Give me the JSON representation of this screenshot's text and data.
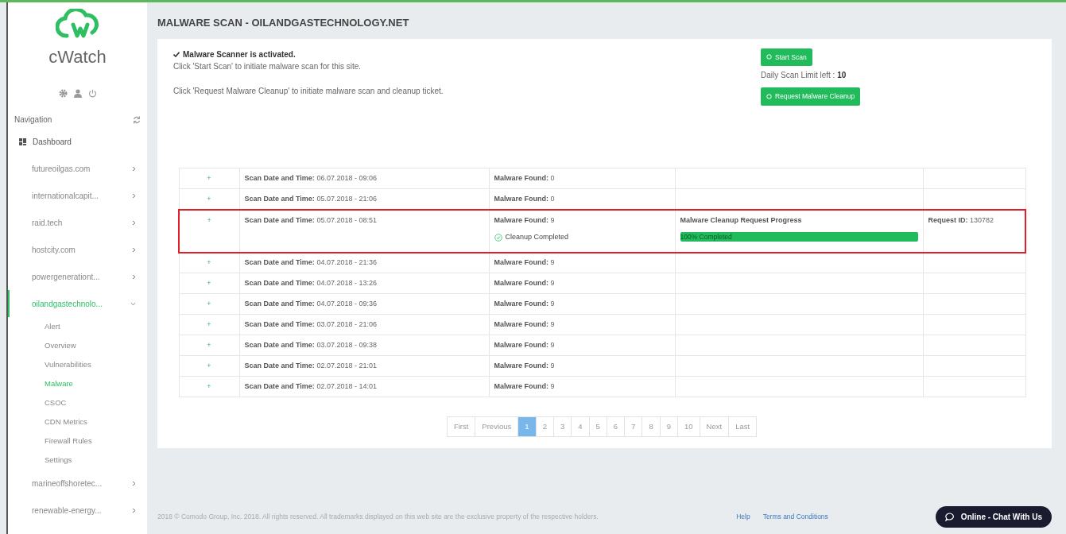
{
  "sidebar": {
    "brand": "cWatch",
    "nav_label": "Navigation",
    "dashboard": "Dashboard",
    "sites": [
      {
        "label": "futureoilgas.com",
        "expanded": false
      },
      {
        "label": "internationalcapit...",
        "expanded": false
      },
      {
        "label": "raid.tech",
        "expanded": false
      },
      {
        "label": "hostcity.com",
        "expanded": false
      },
      {
        "label": "powergenerationt...",
        "expanded": false
      },
      {
        "label": "oilandgastechnolo...",
        "expanded": true,
        "children": [
          {
            "label": "Alert",
            "selected": false
          },
          {
            "label": "Overview",
            "selected": false
          },
          {
            "label": "Vulnerabilities",
            "selected": false
          },
          {
            "label": "Malware",
            "selected": true
          },
          {
            "label": "CSOC",
            "selected": false
          },
          {
            "label": "CDN Metrics",
            "selected": false
          },
          {
            "label": "Firewall Rules",
            "selected": false
          },
          {
            "label": "Settings",
            "selected": false
          }
        ]
      },
      {
        "label": "marineoffshoretec...",
        "expanded": false
      },
      {
        "label": "renewable-energy...",
        "expanded": false
      }
    ]
  },
  "page_title": "MALWARE SCAN - OILANDGASTECHNOLOGY.NET",
  "info": {
    "status": "Malware Scanner is activated.",
    "line_1": "Click 'Start Scan' to initiate malware scan for this site.",
    "line_2": "Click 'Request Malware Cleanup' to initiate malware scan and cleanup ticket.",
    "start_button": "Start Scan",
    "limit_label": "Daily Scan Limit left : ",
    "limit_value": "10",
    "cleanup_button": "Request Malware Cleanup"
  },
  "scans": [
    {
      "kind": "plain",
      "expand": "+",
      "date_label": "Scan Date and Time:",
      "date": "06.07.2018 - 09:06",
      "found_label": "Malware Found:",
      "found": "0",
      "highlighted": false
    },
    {
      "kind": "plain",
      "expand": "+",
      "date_label": "Scan Date and Time:",
      "date": "05.07.2018 - 21:06",
      "found_label": "Malware Found:",
      "found": "0",
      "highlighted": false
    },
    {
      "kind": "cleanup",
      "expand": "+",
      "date_label": "Scan Date and Time:",
      "date": "05.07.2018 - 08:51",
      "found_label": "Malware Found:",
      "found": "9",
      "highlighted": true,
      "cleanup_status": "Cleanup Completed",
      "progress_title": "Malware Cleanup Request Progress",
      "progress_text": "100% Completed",
      "level": 1,
      "request_label": "Request ID:",
      "request_id": "130782"
    },
    {
      "kind": "plain",
      "expand": "+",
      "date_label": "Scan Date and Time:",
      "date": "04.07.2018 - 21:36",
      "found_label": "Malware Found:",
      "found": "9",
      "highlighted": false
    },
    {
      "kind": "plain",
      "expand": "+",
      "date_label": "Scan Date and Time:",
      "date": "04.07.2018 - 13:26",
      "found_label": "Malware Found:",
      "found": "9",
      "highlighted": false
    },
    {
      "kind": "plain",
      "expand": "+",
      "date_label": "Scan Date and Time:",
      "date": "04.07.2018 - 09:36",
      "found_label": "Malware Found:",
      "found": "9",
      "highlighted": false
    },
    {
      "kind": "plain",
      "expand": "+",
      "date_label": "Scan Date and Time:",
      "date": "03.07.2018 - 21:06",
      "found_label": "Malware Found:",
      "found": "9",
      "highlighted": false
    },
    {
      "kind": "plain",
      "expand": "+",
      "date_label": "Scan Date and Time:",
      "date": "03.07.2018 - 09:38",
      "found_label": "Malware Found:",
      "found": "9",
      "highlighted": false
    },
    {
      "kind": "plain",
      "expand": "+",
      "date_label": "Scan Date and Time:",
      "date": "02.07.2018 - 21:01",
      "found_label": "Malware Found:",
      "found": "9",
      "highlighted": false
    },
    {
      "kind": "plain",
      "expand": "+",
      "date_label": "Scan Date and Time:",
      "date": "02.07.2018 - 14:01",
      "found_label": "Malware Found:",
      "found": "9",
      "highlighted": false
    }
  ],
  "pagination": [
    {
      "label": "First",
      "selected": false
    },
    {
      "label": "Previous",
      "selected": false
    },
    {
      "label": "1",
      "selected": true
    },
    {
      "label": "2",
      "selected": false
    },
    {
      "label": "3",
      "selected": false
    },
    {
      "label": "4",
      "selected": false
    },
    {
      "label": "5",
      "selected": false
    },
    {
      "label": "6",
      "selected": false
    },
    {
      "label": "7",
      "selected": false
    },
    {
      "label": "8",
      "selected": false
    },
    {
      "label": "9",
      "selected": false
    },
    {
      "label": "10",
      "selected": false
    },
    {
      "label": "Next",
      "selected": false
    },
    {
      "label": "Last",
      "selected": false
    }
  ],
  "footer": {
    "copyright": "2018 © Comodo Group, Inc. 2018. All rights reserved. All trademarks displayed on this web site are the exclusive property of the respective holders.",
    "links": [
      "Help",
      "Terms and Conditions"
    ],
    "chat_button": "Online - Chat With Us"
  }
}
